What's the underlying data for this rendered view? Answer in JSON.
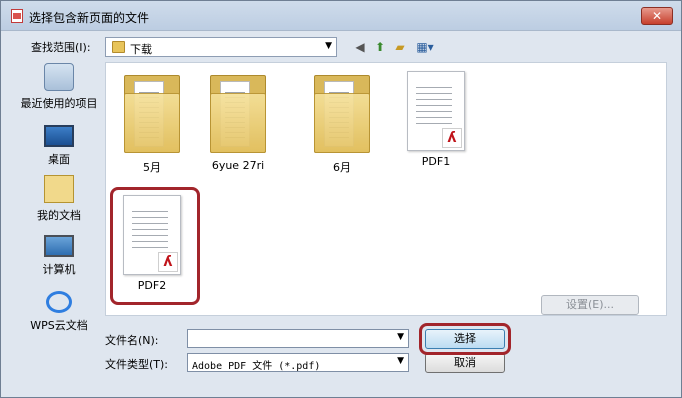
{
  "window": {
    "title": "选择包含新页面的文件",
    "close_label": "✕"
  },
  "lookin": {
    "label": "查找范围(I):",
    "value": "下载"
  },
  "places": [
    {
      "name": "recent",
      "label": "最近使用的项目",
      "icon": "recent-items-icon"
    },
    {
      "name": "desktop",
      "label": "桌面",
      "icon": "desktop-icon"
    },
    {
      "name": "documents",
      "label": "我的文档",
      "icon": "documents-icon"
    },
    {
      "name": "computer",
      "label": "计算机",
      "icon": "computer-icon"
    },
    {
      "name": "wps-cloud",
      "label": "WPS云文档",
      "icon": "cloud-icon"
    }
  ],
  "files": [
    {
      "type": "folder",
      "name": "5月"
    },
    {
      "type": "folder",
      "name": "6yue 27ri"
    },
    {
      "type": "folder",
      "name": "6月"
    },
    {
      "type": "pdf",
      "name": "PDF1"
    },
    {
      "type": "pdf",
      "name": "PDF2",
      "highlighted": true
    }
  ],
  "settings_button": "设置(E)...",
  "filename": {
    "label": "文件名(N):",
    "value": ""
  },
  "filetype": {
    "label": "文件类型(T):",
    "value": "Adobe PDF 文件 (*.pdf)"
  },
  "buttons": {
    "open": "选择",
    "cancel": "取消"
  },
  "colors": {
    "highlight": "#a2252b",
    "pdf_red": "#c0141a"
  }
}
